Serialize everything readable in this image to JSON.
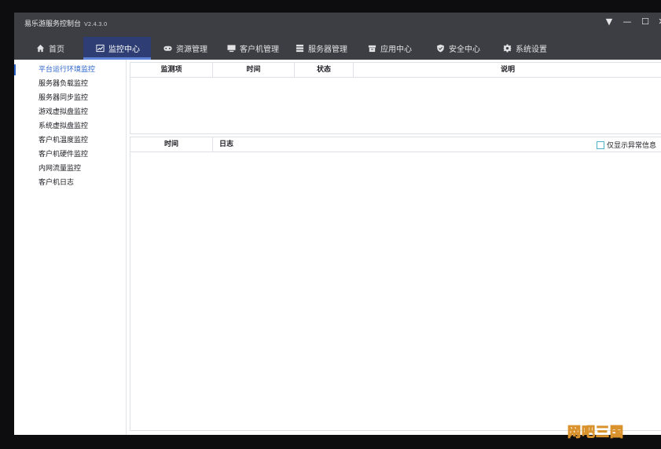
{
  "app": {
    "title": "易乐游服务控制台",
    "version": "V2.4.3.0"
  },
  "window_controls": {
    "menu": "▼",
    "minimize": "—",
    "maximize": "☐",
    "close": "✕"
  },
  "nav": {
    "items": [
      {
        "label": "首页",
        "icon": "home-icon"
      },
      {
        "label": "监控中心",
        "icon": "chart-icon",
        "active": true
      },
      {
        "label": "资源管理",
        "icon": "gamepad-icon"
      },
      {
        "label": "客户机管理",
        "icon": "monitor-icon"
      },
      {
        "label": "服务器管理",
        "icon": "server-icon"
      },
      {
        "label": "应用中心",
        "icon": "box-icon"
      },
      {
        "label": "安全中心",
        "icon": "shield-icon"
      },
      {
        "label": "系统设置",
        "icon": "gear-icon"
      }
    ]
  },
  "sidebar": {
    "items": [
      {
        "label": "平台运行环境监控",
        "active": true
      },
      {
        "label": "服务器负载监控"
      },
      {
        "label": "服务器同步监控"
      },
      {
        "label": "游戏虚拟盘监控"
      },
      {
        "label": "系统虚拟盘监控"
      },
      {
        "label": "客户机温度监控"
      },
      {
        "label": "客户机硬件监控"
      },
      {
        "label": "内网流量监控"
      },
      {
        "label": "客户机日志"
      }
    ]
  },
  "monitor_table": {
    "columns": [
      "监测项",
      "时间",
      "状态",
      "说明"
    ]
  },
  "log_table": {
    "columns": [
      "时间",
      "日志"
    ],
    "filter_label": "仅显示异常信息",
    "filter_checked": false
  },
  "watermark": "网吧三国",
  "colors": {
    "titlebar": "#3d3e43",
    "active_tab": "#2e3e74",
    "accent": "#2b63c9"
  }
}
